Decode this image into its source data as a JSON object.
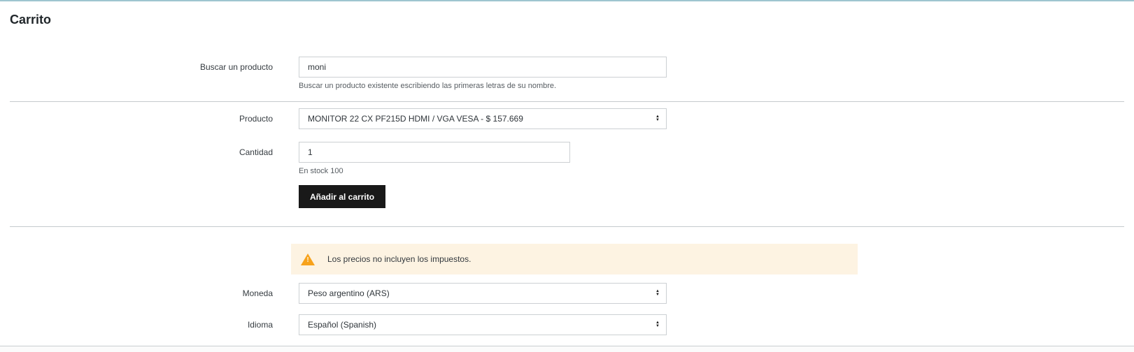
{
  "page": {
    "title": "Carrito"
  },
  "cart_form": {
    "search": {
      "label": "Buscar un producto",
      "value": "moni",
      "help": "Buscar un producto existente escribiendo las primeras letras de su nombre."
    },
    "product": {
      "label": "Producto",
      "selected_option": "MONITOR 22 CX PF215D HDMI / VGA VESA - $ 157.669"
    },
    "quantity": {
      "label": "Cantidad",
      "value": "1",
      "help": "En stock 100"
    },
    "add_to_cart_label": "Añadir al carrito"
  },
  "preferences": {
    "tax_warning": "Los precios no incluyen los impuestos.",
    "currency": {
      "label": "Moneda",
      "selected_option": "Peso argentino (ARS)"
    },
    "language": {
      "label": "Idioma",
      "selected_option": "Español (Spanish)"
    }
  },
  "icons": {
    "select_arrows_up": "▲",
    "select_arrows_down": "▼",
    "warning_exclamation": "!"
  },
  "colors": {
    "top_accent_bar": "#9ec5cf",
    "button_background": "#191919",
    "warning_banner_background": "#fdf3e2",
    "warning_icon_orange": "#f7a21b",
    "divider_gray": "#c5cacd"
  }
}
